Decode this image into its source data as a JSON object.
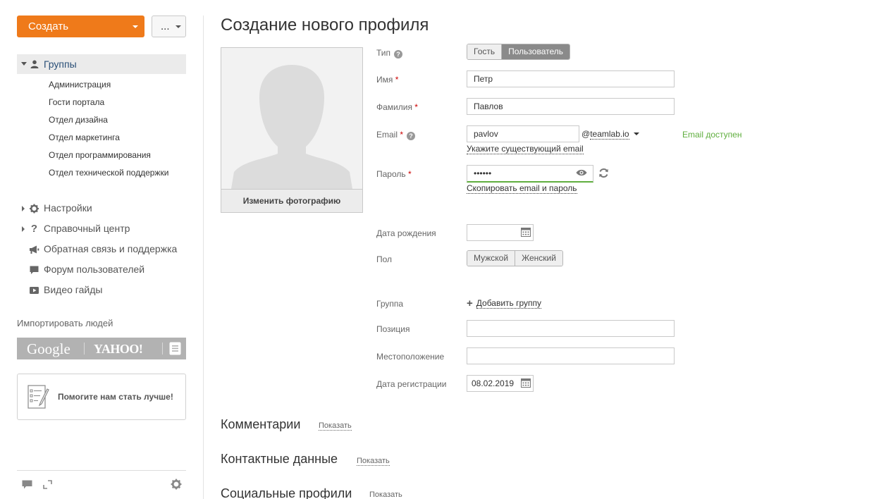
{
  "sidebar": {
    "create_label": "Создать",
    "more_label": "...",
    "groups_label": "Группы",
    "group_items": [
      "Администрация",
      "Гости портала",
      "Отдел дизайна",
      "Отдел маркетинга",
      "Отдел программирования",
      "Отдел технической поддержки"
    ],
    "nav_items": [
      "Настройки",
      "Справочный центр",
      "Обратная связь и поддержка",
      "Форум пользователей",
      "Видео гайды"
    ],
    "import_label": "Импортировать людей",
    "import_google": "Google",
    "import_yahoo": "YAHOO!",
    "feedback_label": "Помогите нам стать лучше!"
  },
  "main": {
    "title": "Создание нового профиля",
    "change_photo_label": "Изменить фотографию",
    "form": {
      "type_label": "Тип",
      "type_options": [
        "Гость",
        "Пользователь"
      ],
      "type_selected": "Пользователь",
      "first_name_label": "Имя",
      "first_name_value": "Петр",
      "last_name_label": "Фамилия",
      "last_name_value": "Павлов",
      "email_label": "Email",
      "email_value": "pavlov",
      "email_at": "@",
      "email_domain": "teamlab.io",
      "email_status": "Email доступен",
      "email_existing_link": "Укажите существующий email",
      "password_label": "Пароль",
      "password_value": "••••••",
      "copy_link": "Скопировать email и пароль",
      "birthdate_label": "Дата рождения",
      "birthdate_value": "",
      "gender_label": "Пол",
      "gender_options": [
        "Мужской",
        "Женский"
      ],
      "group_label": "Группа",
      "add_group_label": "Добавить группу",
      "position_label": "Позиция",
      "position_value": "",
      "location_label": "Местоположение",
      "location_value": "",
      "regdate_label": "Дата регистрации",
      "regdate_value": "08.02.2019"
    },
    "sections": {
      "comments_title": "Комментарии",
      "contacts_title": "Контактные данные",
      "social_title": "Социальные профили",
      "show_label": "Показать"
    }
  },
  "colors": {
    "accent": "#ef7a1a",
    "success": "#5fae3e",
    "toggle_active": "#8a8a8a"
  }
}
